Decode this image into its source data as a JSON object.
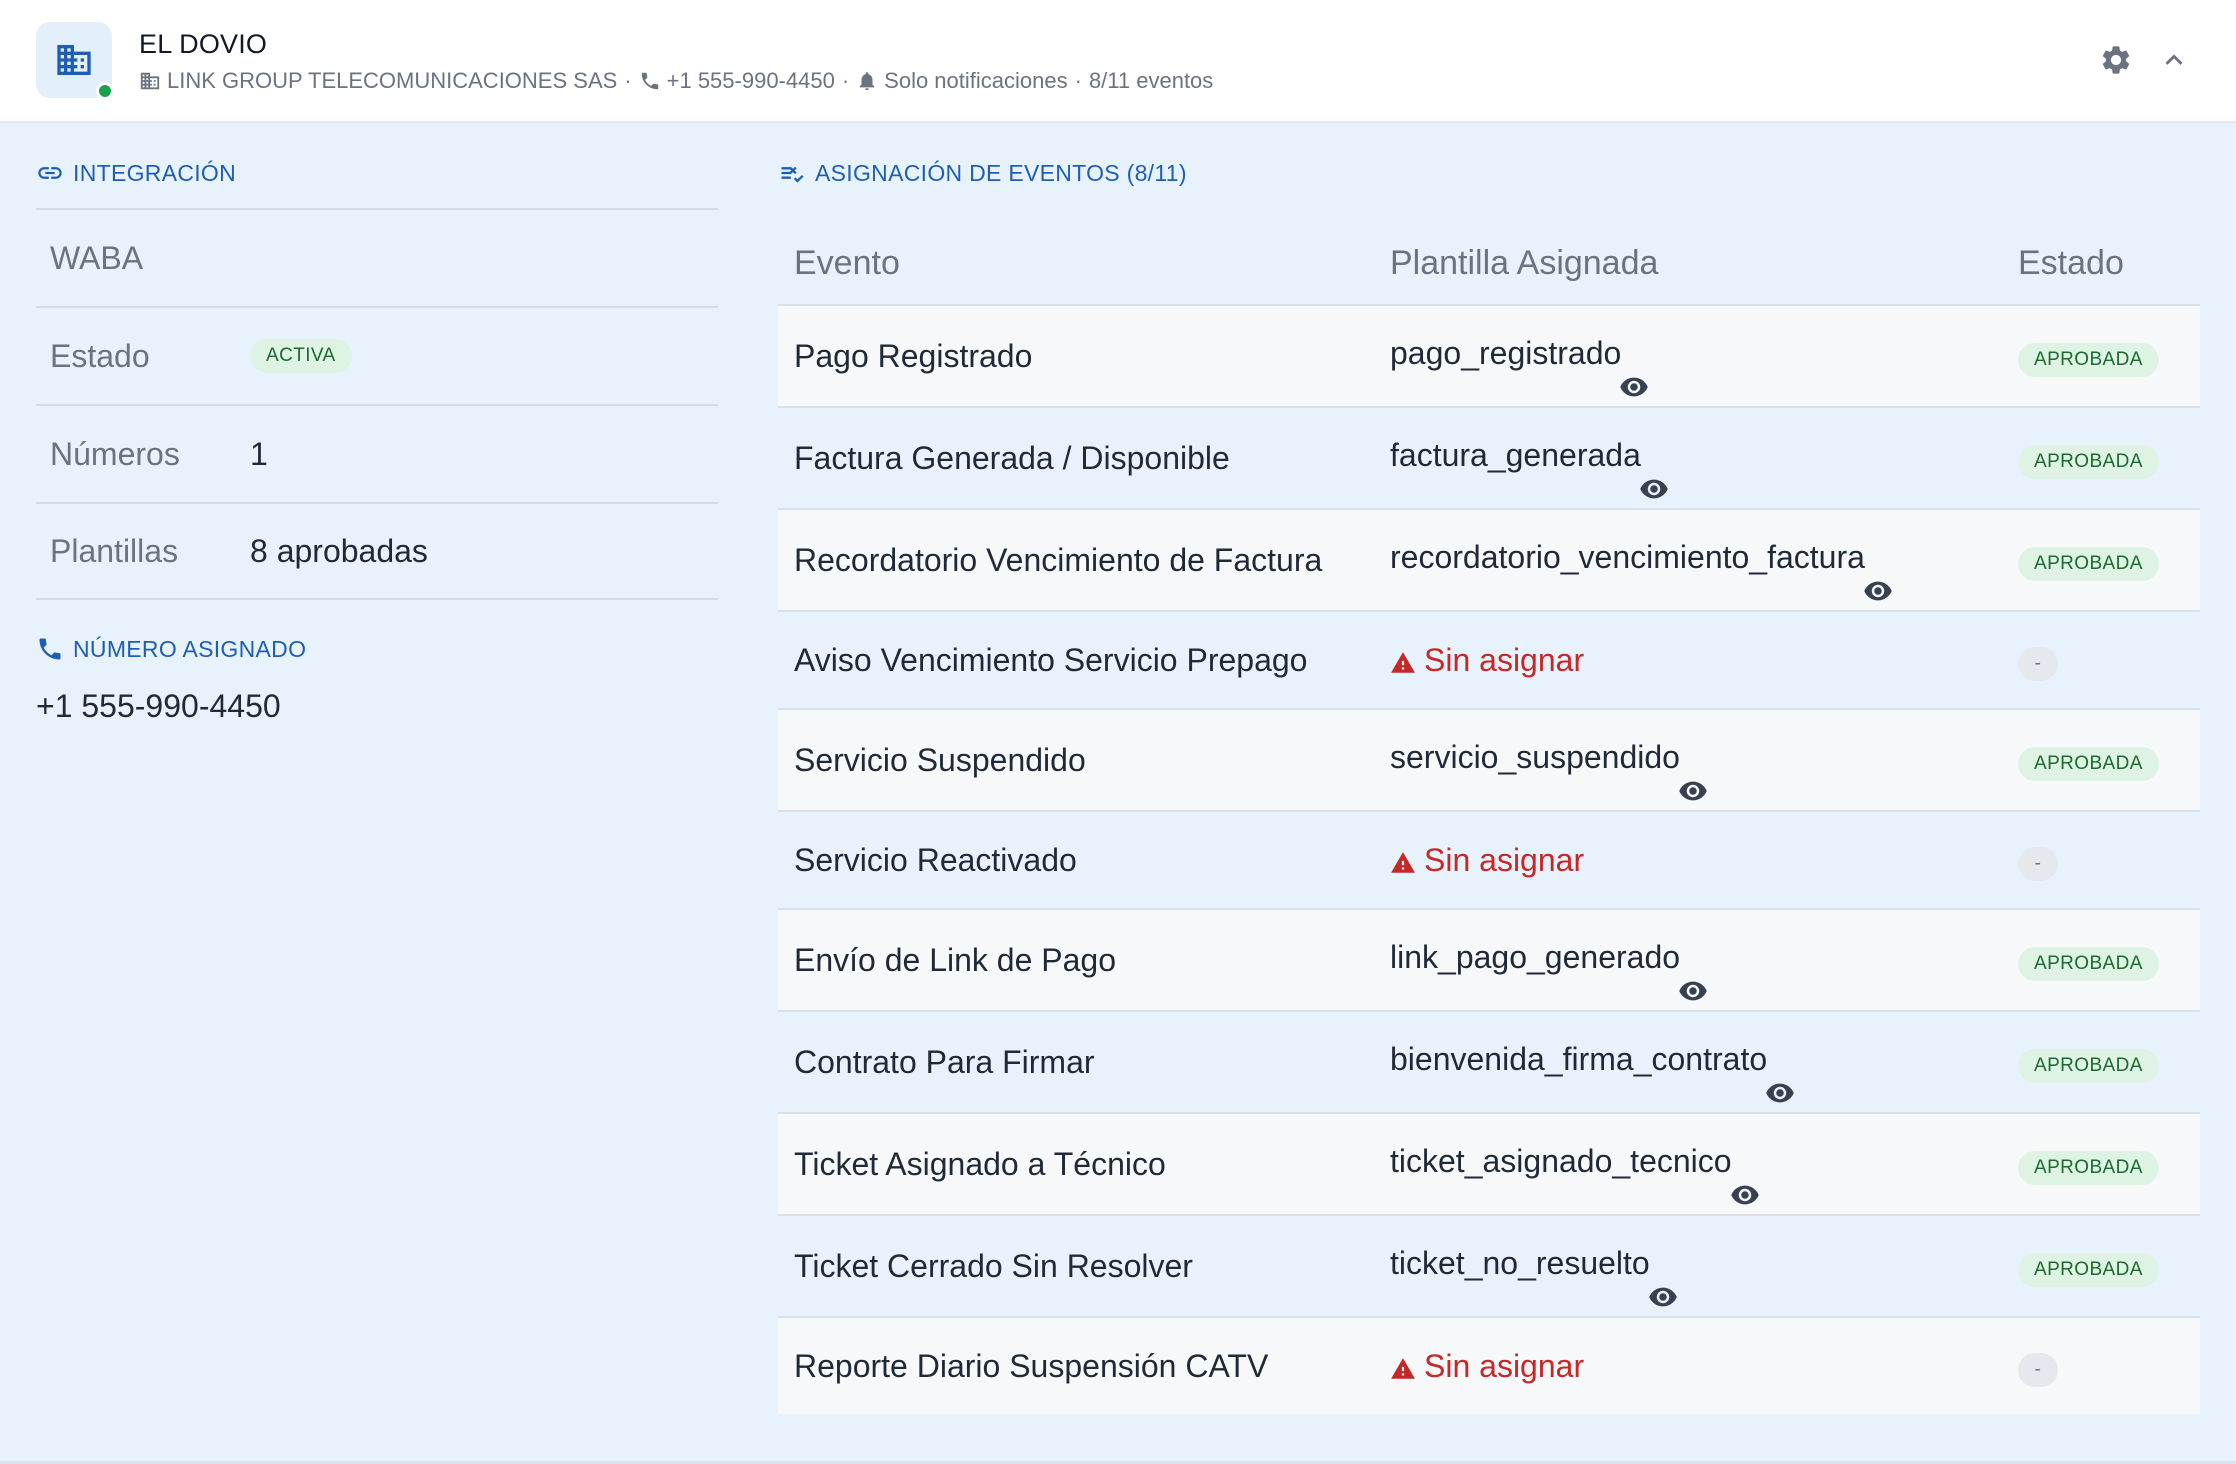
{
  "header": {
    "client_name": "EL DOVIO",
    "company": "LINK GROUP TELECOMUNICACIONES SAS",
    "phone": "+1 555-990-4450",
    "notification_mode": "Solo notificaciones",
    "events_count": "8/11 eventos",
    "separator": "·",
    "status_color": "#16a34a",
    "icons": [
      "building-icon",
      "phone-icon",
      "bell-icon",
      "gear-icon",
      "chevron-up-icon"
    ]
  },
  "integration": {
    "title": "INTEGRACIÓN",
    "rows": [
      {
        "label": "WABA",
        "value": ""
      },
      {
        "label": "Estado",
        "value": "ACTIVA"
      },
      {
        "label": "Números",
        "value": "1"
      },
      {
        "label": "Plantillas",
        "value": "8 aprobadas"
      }
    ]
  },
  "assigned_number": {
    "title": "NÚMERO ASIGNADO",
    "value": "+1 555-990-4450"
  },
  "events": {
    "title": "ASIGNACIÓN DE EVENTOS (8/11)",
    "columns": [
      "Evento",
      "Plantilla Asignada",
      "Estado"
    ],
    "unassigned_label": "Sin asignar",
    "empty_state": "-",
    "rows": [
      {
        "event": "Pago Registrado",
        "template": "pago_registrado",
        "state": "APROBADA"
      },
      {
        "event": "Factura Generada / Disponible",
        "template": "factura_generada",
        "state": "APROBADA"
      },
      {
        "event": "Recordatorio Vencimiento de Factura",
        "template": "recordatorio_vencimiento_factura",
        "state": "APROBADA"
      },
      {
        "event": "Aviso Vencimiento Servicio Prepago",
        "template": "",
        "state": "-"
      },
      {
        "event": "Servicio Suspendido",
        "template": "servicio_suspendido",
        "state": "APROBADA"
      },
      {
        "event": "Servicio Reactivado",
        "template": "",
        "state": "-"
      },
      {
        "event": "Envío de Link de Pago",
        "template": "link_pago_generado",
        "state": "APROBADA"
      },
      {
        "event": "Contrato Para Firmar",
        "template": "bienvenida_firma_contrato",
        "state": "APROBADA"
      },
      {
        "event": "Ticket Asignado a Técnico",
        "template": "ticket_asignado_tecnico",
        "state": "APROBADA"
      },
      {
        "event": "Ticket Cerrado Sin Resolver",
        "template": "ticket_no_resuelto",
        "state": "APROBADA"
      },
      {
        "event": "Reporte Diario Suspensión CATV",
        "template": "",
        "state": "-"
      }
    ]
  },
  "colors": {
    "accent": "#1e5fb4",
    "approved_bg": "#dff3e4",
    "approved_text": "#1b6b2f",
    "unassigned": "#c62828",
    "body_bg": "#e8f2fc"
  }
}
